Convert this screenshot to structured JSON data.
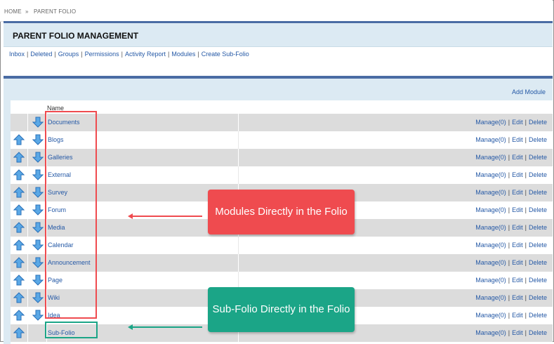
{
  "breadcrumb": {
    "home": "HOME",
    "separator": "»",
    "current": "PARENT FOLIO"
  },
  "management": {
    "title": "PARENT FOLIO MANAGEMENT",
    "links": [
      "Inbox",
      "Deleted",
      "Groups",
      "Permissions",
      "Activity Report",
      "Modules",
      "Create Sub-Folio"
    ],
    "link_separator": "|"
  },
  "modules": {
    "add_label": "Add Module",
    "name_header": "Name",
    "action_manage": "Manage(0)",
    "action_edit": "Edit",
    "action_delete": "Delete",
    "action_separator": "|",
    "rows": [
      {
        "name": "Documents",
        "has_up": false,
        "has_down": true
      },
      {
        "name": "Blogs",
        "has_up": true,
        "has_down": true
      },
      {
        "name": "Galleries",
        "has_up": true,
        "has_down": true
      },
      {
        "name": "External",
        "has_up": true,
        "has_down": true
      },
      {
        "name": "Survey",
        "has_up": true,
        "has_down": true
      },
      {
        "name": "Forum",
        "has_up": true,
        "has_down": true
      },
      {
        "name": "Media",
        "has_up": true,
        "has_down": true
      },
      {
        "name": "Calendar",
        "has_up": true,
        "has_down": true
      },
      {
        "name": "Announcement",
        "has_up": true,
        "has_down": true
      },
      {
        "name": "Page",
        "has_up": true,
        "has_down": true
      },
      {
        "name": "Wiki",
        "has_up": true,
        "has_down": true
      },
      {
        "name": "Idea",
        "has_up": true,
        "has_down": true
      },
      {
        "name": "Sub-Folio",
        "has_up": true,
        "has_down": false
      }
    ]
  },
  "annotations": {
    "modules_callout": "Modules Directly in the Folio",
    "subfolio_callout": "Sub-Folio Directly in the Folio"
  },
  "colors": {
    "accent_blue": "#4a6ca4",
    "link_blue": "#2559a6",
    "callout_red": "#ef4b4f",
    "callout_green": "#1ba587",
    "header_bg": "#dceaf3",
    "row_shade": "#dcdcdc"
  },
  "icons": {
    "move_up": "arrow-up-icon",
    "move_down": "arrow-down-icon"
  }
}
